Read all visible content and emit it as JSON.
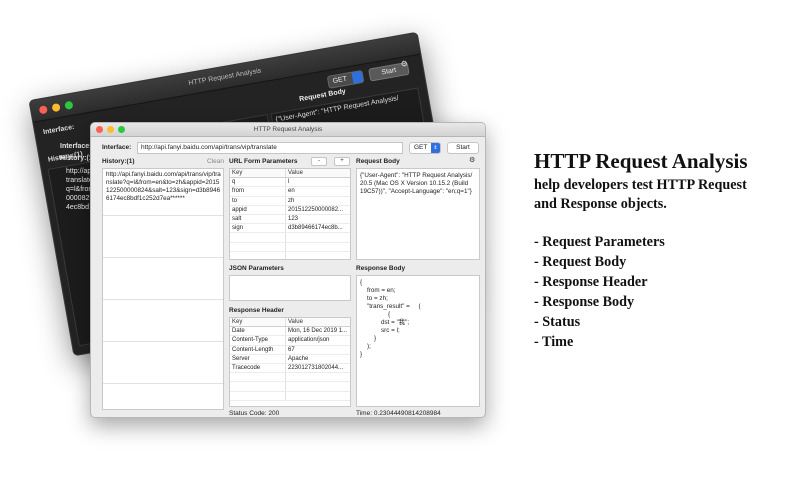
{
  "back_window": {
    "title": "HTTP Request Analysis",
    "interface_label": "Interface:",
    "method": "GET",
    "start_label": "Start",
    "history_label": "History:(1)",
    "request_body_label": "Request Body",
    "body_snippet": "{\"User-Agent\": \"HTTP Request Analysis/",
    "history_peek": [
      "http://api.",
      "translate?",
      "q=l&from=",
      "0000827",
      "4ec8bd"
    ]
  },
  "front_window": {
    "title": "HTTP Request Analysis",
    "interface_label": "Interface:",
    "url": "http://api.fanyi.baidu.com/api/trans/vip/translate",
    "method": "GET",
    "start_label": "Start",
    "history_label": "History:(1)",
    "clean_label": "Clean",
    "history_entry": "http://api.fanyi.baidu.com/api/trans/vip/translate?q=l&from=en&to=zh&appid=2015122500000824&salt=123&sign=d3b89466174ec8bdf1c252d7ea******",
    "url_form": {
      "label": "URL Form Parameters",
      "minus": "-",
      "plus": "+",
      "key_header": "Key",
      "value_header": "Value",
      "rows": [
        {
          "key": "q",
          "value": "l"
        },
        {
          "key": "from",
          "value": "en"
        },
        {
          "key": "to",
          "value": "zh"
        },
        {
          "key": "appid",
          "value": "201512250000082..."
        },
        {
          "key": "salt",
          "value": "123"
        },
        {
          "key": "sign",
          "value": "d3b89466174ec8b..."
        }
      ]
    },
    "json_params_label": "JSON Parameters",
    "response_header": {
      "label": "Response Header",
      "key_header": "Key",
      "value_header": "Value",
      "rows": [
        {
          "key": "Date",
          "value": "Mon, 16 Dec 2019 1..."
        },
        {
          "key": "Content-Type",
          "value": "application/json"
        },
        {
          "key": "Content-Length",
          "value": "67"
        },
        {
          "key": "Server",
          "value": "Apache"
        },
        {
          "key": "Tracecode",
          "value": "223012731802044..."
        }
      ]
    },
    "request_body": {
      "label": "Request Body",
      "text": "{\"User-Agent\": \"HTTP Request Analysis/\n20.5 (Mac OS X Version 10.15.2 (Build\n19C57))\", \"Accept-Language\": \"en;q=1\"}"
    },
    "response_body": {
      "label": "Response Body",
      "text": "{\n    from = en;\n    to = zh;\n    \"trans_result\" =     (\n                {\n            dst = \"我\";\n            src = l;\n        }\n    );\n}"
    },
    "status": "Status Code: 200",
    "time": "Time: 0.23044490814208984"
  },
  "promo": {
    "title": "HTTP Request Analysis",
    "subtitle_line1": "help developers test HTTP Request",
    "subtitle_line2": "and Response objects.",
    "features": [
      "- Request Parameters",
      "- Request Body",
      "- Response Header",
      "- Response Body",
      "- Status",
      "- Time"
    ]
  }
}
